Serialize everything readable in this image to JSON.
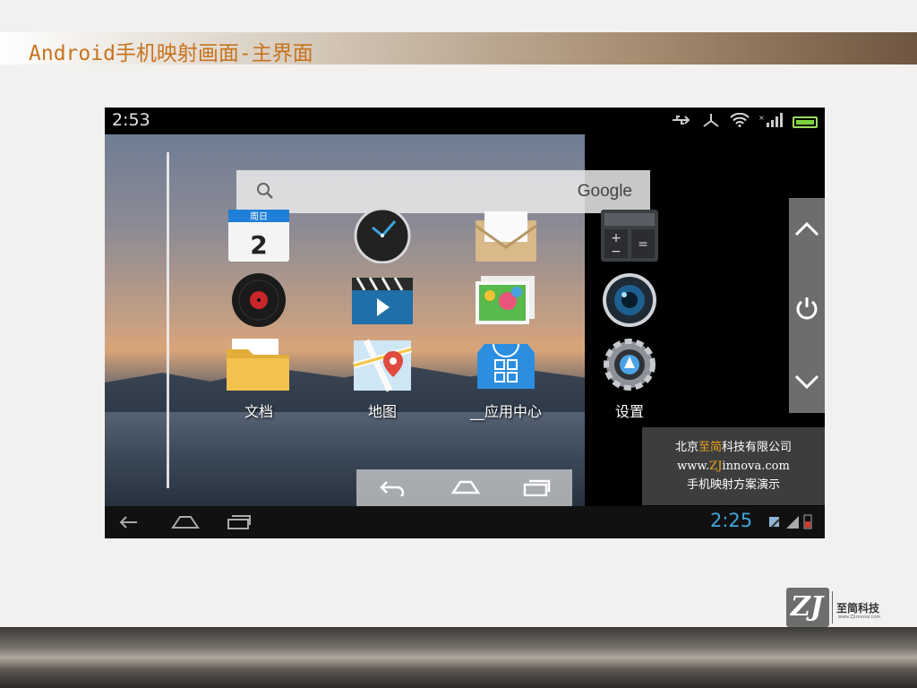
{
  "slide": {
    "title": "Android手机映射画面-主界面"
  },
  "statusbar": {
    "time": "2:53"
  },
  "search": {
    "brand": "Google"
  },
  "apps": [
    {
      "label": "",
      "icon": "calendar-icon",
      "calendar_day_header": "周日",
      "calendar_date": "2"
    },
    {
      "label": "",
      "icon": "clock-icon"
    },
    {
      "label": "",
      "icon": "email-icon"
    },
    {
      "label": "",
      "icon": "calculator-icon"
    },
    {
      "label": "",
      "icon": "music-icon"
    },
    {
      "label": "",
      "icon": "video-icon"
    },
    {
      "label": "",
      "icon": "gallery-icon"
    },
    {
      "label": "",
      "icon": "camera-icon"
    },
    {
      "label": "文档",
      "icon": "folder-icon"
    },
    {
      "label": "地图",
      "icon": "map-icon"
    },
    {
      "label": "__应用中心",
      "icon": "app-center-icon"
    },
    {
      "label": "设置",
      "icon": "settings-icon"
    }
  ],
  "bottom_bar": {
    "time": "2:25"
  },
  "company_box": {
    "line1_prefix": "北京",
    "line1_accent": "至简",
    "line1_suffix": "科技有限公司",
    "line2_prefix": "www.",
    "line2_accent": "ZJ",
    "line2_suffix": "innova.com",
    "line3": "手机映射方案演示"
  },
  "logo": {
    "mark": "ZJ",
    "name": "至简科技",
    "url": "www.ZJinnova.com"
  },
  "colors": {
    "title": "#c8731e",
    "accent": "#e8a21c",
    "clock_blue": "#3ea6d9",
    "battery_green": "#7cd23b"
  }
}
